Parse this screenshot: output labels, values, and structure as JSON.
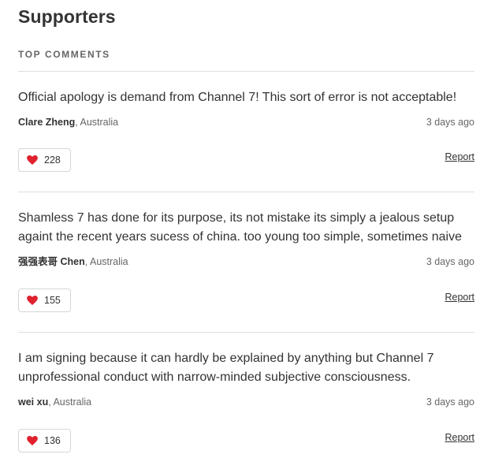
{
  "page": {
    "title": "Supporters",
    "section_label": "TOP COMMENTS",
    "like_icon": "heart-icon",
    "like_icon_color": "#e0212e"
  },
  "comments": [
    {
      "text": "Official apology is demand from Channel 7! This sort of error is not acceptable!",
      "author": "Clare Zheng",
      "location": ", Australia",
      "time": "3 days ago",
      "likes": "228",
      "report_label": "Report"
    },
    {
      "text": "Shamless 7 has done for its purpose, its not mistake its simply a jealous setup againt the recent years sucess of china. too young too simple, sometimes naive",
      "author": "强强表哥 Chen",
      "location": ", Australia",
      "time": "3 days ago",
      "likes": "155",
      "report_label": "Report"
    },
    {
      "text": "I am signing because it can hardly be explained by anything but Channel 7 unprofessional conduct with narrow-minded subjective consciousness.",
      "author": "wei xu",
      "location": ", Australia",
      "time": "3 days ago",
      "likes": "136",
      "report_label": "Report"
    }
  ]
}
